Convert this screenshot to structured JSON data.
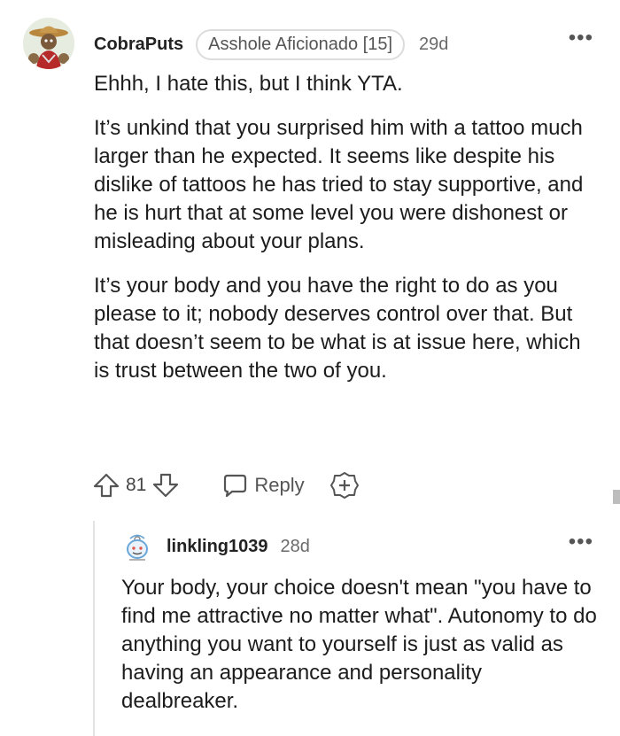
{
  "comment": {
    "username": "CobraPuts",
    "flair": "Asshole Aficionado [15]",
    "age": "29d",
    "more_icon": "more-dots-icon",
    "paragraphs": [
      "Ehhh, I hate this, but I think YTA.",
      "It’s unkind that you surprised him with a tattoo much larger than he expected. It seems like despite his dislike of tattoos he has tried to stay supportive, and he is hurt that at some level you were dishonest or misleading about your plans.",
      "It’s your body and you have the right to do as you please to it; nobody deserves control over that. But that doesn’t seem to be what is at issue here, which is trust between the two of you."
    ],
    "votes": "81",
    "reply_label": "Reply"
  },
  "reply": {
    "username": "linkling1039",
    "age": "28d",
    "text": "Your body, your choice doesn't mean \"you have to find me attractive no matter what\". Autonomy to do anything you want to yourself is just as valid as having an appearance and personality dealbreaker."
  }
}
